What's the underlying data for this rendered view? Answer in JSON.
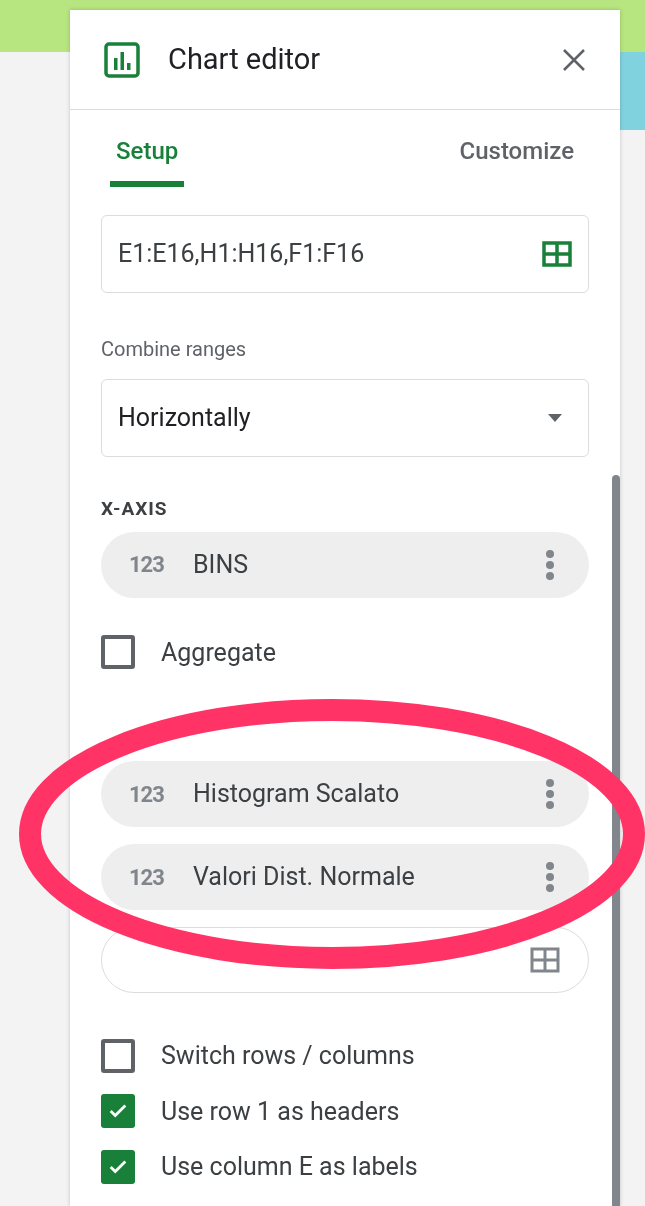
{
  "panel": {
    "title": "Chart editor"
  },
  "tabs": [
    {
      "label": "Setup",
      "selected": true
    },
    {
      "label": "Customize",
      "selected": false
    }
  ],
  "data_range": {
    "value": "E1:E16,H1:H16,F1:F16"
  },
  "combine_ranges": {
    "label": "Combine ranges",
    "value": "Horizontally"
  },
  "x_axis": {
    "label": "X-AXIS",
    "items": [
      {
        "type_badge": "123",
        "name": "BINS"
      }
    ]
  },
  "aggregate": {
    "label": "Aggregate",
    "checked": false
  },
  "series": [
    {
      "type_badge": "123",
      "name": "Histogram Scalato"
    },
    {
      "type_badge": "123",
      "name": "Valori Dist. Normale"
    }
  ],
  "options": [
    {
      "label": "Switch rows / columns",
      "checked": false
    },
    {
      "label": "Use row 1 as headers",
      "checked": true
    },
    {
      "label": "Use column E as labels",
      "checked": true
    }
  ]
}
